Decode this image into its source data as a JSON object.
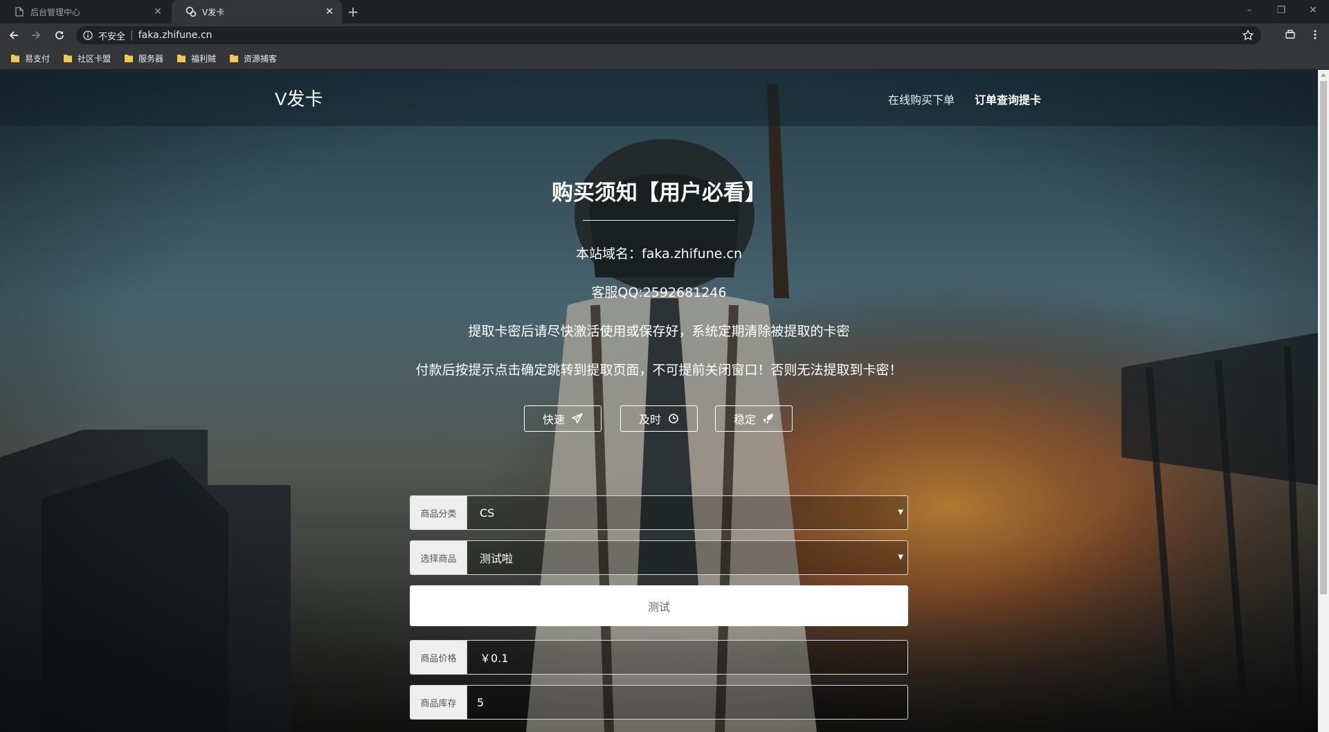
{
  "browser": {
    "tabs": [
      {
        "title": "后台管理中心",
        "icon": "page-icon",
        "active": false
      },
      {
        "title": "V发卡",
        "icon": "loading-favicon-icon",
        "active": true
      }
    ],
    "address": {
      "security_label": "不安全",
      "url": "faka.zhifune.cn"
    },
    "bookmarks": [
      "易支付",
      "社区卡盟",
      "服务器",
      "福利贼",
      "资源捕客"
    ]
  },
  "site": {
    "brand": "V发卡",
    "nav": [
      "在线购买下单",
      "订单查询提卡"
    ]
  },
  "notice": {
    "title": "购买须知【用户必看】",
    "lines": [
      "本站域名：faka.zhifune.cn",
      "客服QQ:2592681246",
      "提取卡密后请尽快激活使用或保存好，系统定期清除被提取的卡密",
      "付款后按提示点击确定跳转到提取页面，不可提前关闭窗口！否则无法提取到卡密！"
    ]
  },
  "features": [
    {
      "label": "快速",
      "icon": "paper-plane-icon"
    },
    {
      "label": "及时",
      "icon": "clock-icon"
    },
    {
      "label": "稳定",
      "icon": "rocket-icon"
    }
  ],
  "form": {
    "category": {
      "label": "商品分类",
      "value": "CS"
    },
    "product": {
      "label": "选择商品",
      "value": "测试啦"
    },
    "description": "测试",
    "price": {
      "label": "商品价格",
      "value": "￥0.1"
    },
    "stock": {
      "label": "商品库存",
      "value": "5"
    }
  },
  "colors": {
    "chrome_dark": "#202124",
    "chrome_toolbar": "#35363a",
    "bookmark_folder": "#f2c94c"
  }
}
